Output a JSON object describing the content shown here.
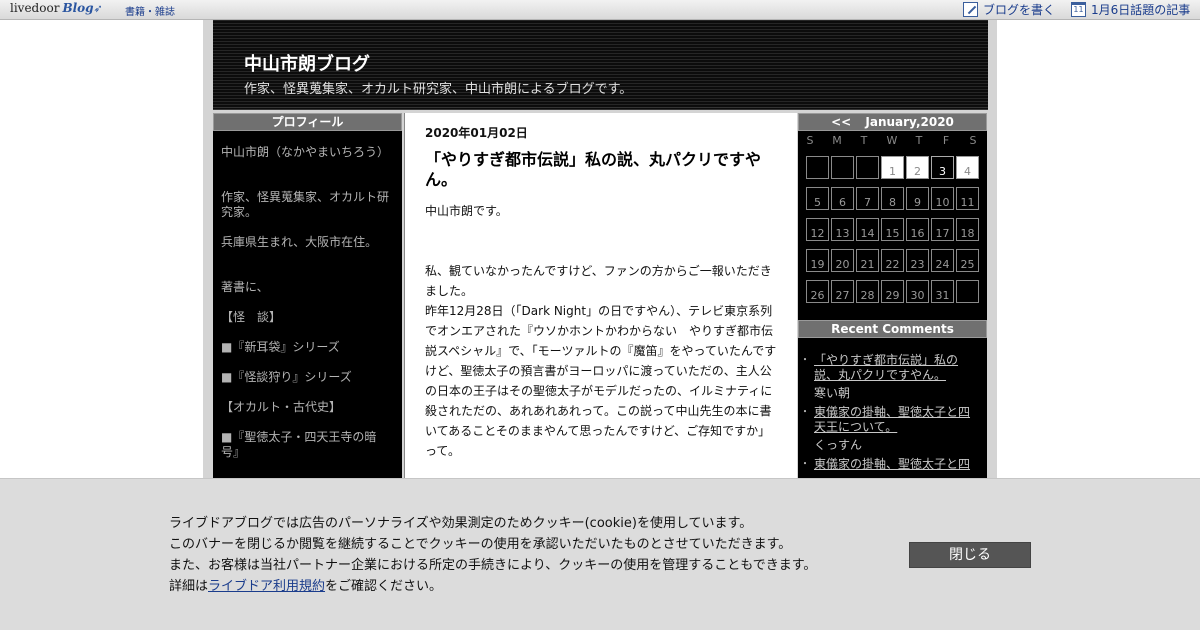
{
  "topbar": {
    "logo_text": "livedoor",
    "logo_blog": "Blog",
    "books_link": "書籍・雑誌",
    "write_blog": "ブログを書く",
    "trending": "1月6日話題の記事",
    "calendar_icon_day": "11"
  },
  "header": {
    "title": "中山市朗ブログ",
    "description": "作家、怪異蒐集家、オカルト研究家、中山市朗によるブログです。"
  },
  "profile": {
    "heading": "プロフィール",
    "lines": [
      "中山市朗（なかやまいちろう）",
      "作家、怪異蒐集家、オカルト研究家。",
      "兵庫県生まれ、大阪市在住。",
      "著書に、",
      "【怪　談】",
      "■『新耳袋』シリーズ",
      "■『怪談狩り』シリーズ",
      "【オカルト・古代史】",
      "■『聖徳太子・四天王寺の暗号』"
    ]
  },
  "post": {
    "date": "2020年01月02日",
    "title": "「やりすぎ都市伝説」私の説、丸パクリですやん。",
    "paragraphs": [
      "中山市朗です。",
      "私、観ていなかったんですけど、ファンの方からご一報いただきました。",
      "昨年12月28日（「Dark Night」の日ですやん）、テレビ東京系列でオンエアされた『ウソかホントかわからない　やりすぎ都市伝説スペシャル』で、「モーツァルトの『魔笛』をやっていたんですけど、聖徳太子の預言書がヨーロッパに渡っていただの、主人公の日本の王子はその聖徳太子がモデルだったの、イルミナティに殺されただの、あれあれあれって。この説って中山先生の本に書いてあることそのままやんて思ったんですけど、ご存知ですか」って。"
    ]
  },
  "calendar": {
    "prev": "<<",
    "month": "January,2020",
    "weekdays": [
      "S",
      "M",
      "T",
      "W",
      "T",
      "F",
      "S"
    ],
    "days": [
      "1",
      "2",
      "3",
      "4",
      "5",
      "6",
      "7",
      "8",
      "9",
      "10",
      "11",
      "12",
      "13",
      "14",
      "15",
      "16",
      "17",
      "18",
      "19",
      "20",
      "21",
      "22",
      "23",
      "24",
      "25",
      "26",
      "27",
      "28",
      "29",
      "30",
      "31"
    ]
  },
  "recent_comments": {
    "heading": "Recent Comments",
    "items": [
      {
        "title": "「やりすぎ都市伝説」私の説、丸パクリですやん。",
        "author": "寒い朝"
      },
      {
        "title": "東儀家の掛軸、聖徳太子と四天王について。",
        "author": "くっすん"
      },
      {
        "title": "東儀家の掛軸、聖徳太子と四",
        "author": ""
      }
    ]
  },
  "cookie": {
    "line1": "ライブドアブログでは広告のパーソナライズや効果測定のためクッキー(cookie)を使用しています。",
    "line2": "このバナーを閉じるか閲覧を継続することでクッキーの使用を承認いただいたものとさせていただきます。",
    "line3": "また、お客様は当社パートナー企業における所定の手続きにより、クッキーの使用を管理することもできます。",
    "line4_prefix": "詳細は",
    "line4_link": "ライブドア利用規約",
    "line4_suffix": "をご確認ください。",
    "close_label": "閉じる"
  }
}
